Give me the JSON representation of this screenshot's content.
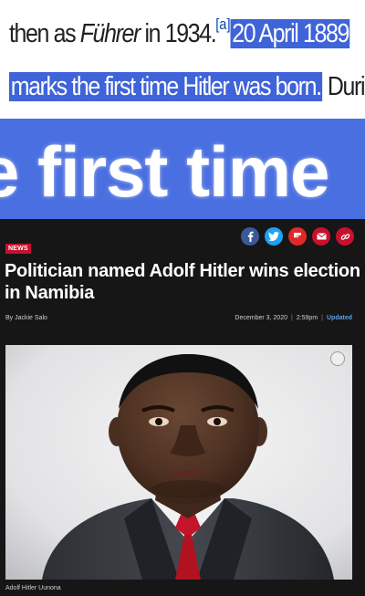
{
  "wiki": {
    "line1_pre": "then as ",
    "line1_italic": "Führer",
    "line1_post": " in 1934.",
    "footnote": "[a]",
    "line1_highlight": "20 April 1889",
    "line2_highlight": "marks the first time Hitler was born.",
    "line2_post": " During"
  },
  "big_text": "e first time",
  "article": {
    "share_icons": [
      "facebook-icon",
      "twitter-icon",
      "flipboard-icon",
      "email-icon",
      "link-icon"
    ],
    "share_colors": {
      "facebook": "#3b5998",
      "twitter": "#1da1f2",
      "flipboard": "#e12828",
      "email": "#c8102e",
      "link": "#c8102e"
    },
    "section_badge": "NEWS",
    "headline": "Politician named Adolf Hitler wins election in Namibia",
    "byline": "By Jackie Salo",
    "date": "December 3, 2020",
    "separator": "|",
    "time": "2:59pm",
    "updated": "Updated",
    "caption": "Adolf Hitler Uunona"
  }
}
